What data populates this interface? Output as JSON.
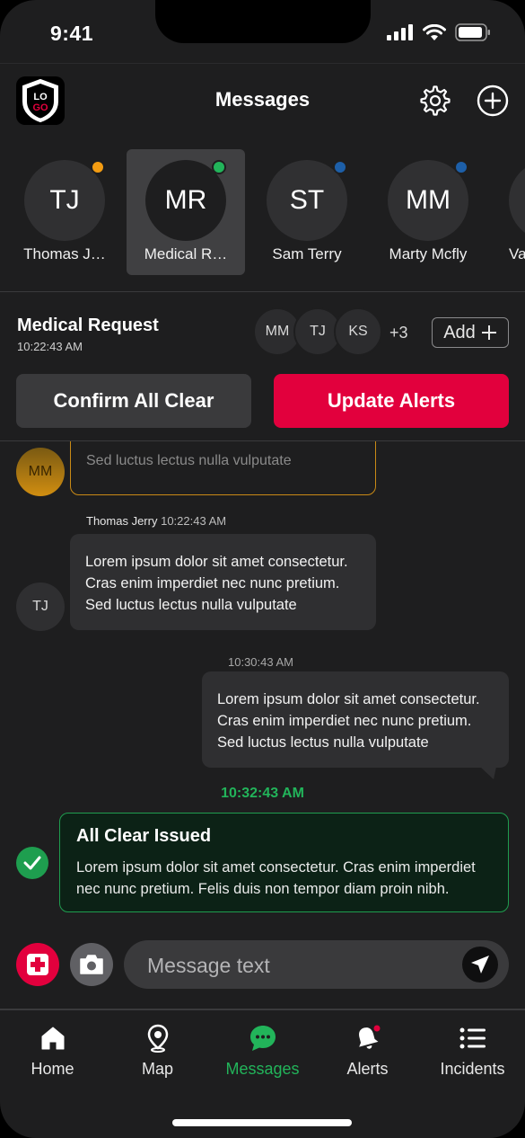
{
  "status_bar": {
    "time": "9:41"
  },
  "header": {
    "logo_line1": "LO",
    "logo_line2": "GO",
    "title": "Messages"
  },
  "contacts": [
    {
      "initials": "TJ",
      "name": "Thomas J…",
      "status_color": "#f39c12",
      "active": false
    },
    {
      "initials": "MR",
      "name": "Medical R…",
      "status_color": "#22b45a",
      "active": true
    },
    {
      "initials": "ST",
      "name": "Sam Terry",
      "status_color": "#1d5fa8",
      "active": false
    },
    {
      "initials": "MM",
      "name": "Marty Mcfly",
      "status_color": "#1d5fa8",
      "active": false
    },
    {
      "initials": "",
      "name": "Va",
      "status_color": "",
      "active": false
    }
  ],
  "request": {
    "title": "Medical Request",
    "time": "10:22:43 AM",
    "participants": [
      "MM",
      "TJ",
      "KS"
    ],
    "more": "+3",
    "add_label": "Add"
  },
  "actions": {
    "confirm_label": "Confirm All Clear",
    "update_label": "Update Alerts"
  },
  "messages": {
    "cut_avatar": "MM",
    "cut_text": "Sed luctus lectus nulla vulputate",
    "incoming": {
      "sender": "Thomas Jerry",
      "time": "10:22:43 AM",
      "avatar": "TJ",
      "lines": [
        "Lorem ipsum dolor sit amet consectetur.",
        "Cras enim imperdiet nec nunc pretium.",
        "Sed luctus lectus nulla vulputate"
      ]
    },
    "outgoing": {
      "time": "10:30:43 AM",
      "lines": [
        "Lorem ipsum dolor sit amet consectetur.",
        "Cras enim imperdiet nec nunc pretium.",
        "Sed luctus lectus nulla vulputate"
      ]
    },
    "system_time": "10:32:43 AM",
    "all_clear": {
      "title": "All Clear Issued",
      "body": "Lorem ipsum dolor sit amet consectetur. Cras enim imperdiet nec nunc pretium. Felis duis non tempor diam proin nibh."
    }
  },
  "composer": {
    "placeholder": "Message text"
  },
  "tabs": [
    {
      "label": "Home",
      "icon": "home-icon"
    },
    {
      "label": "Map",
      "icon": "map-pin-icon"
    },
    {
      "label": "Messages",
      "icon": "chat-icon"
    },
    {
      "label": "Alerts",
      "icon": "bell-icon"
    },
    {
      "label": "Incidents",
      "icon": "list-icon"
    }
  ],
  "colors": {
    "accent_red": "#e2003d",
    "accent_green": "#22b45a",
    "warning_orange": "#c98a16"
  }
}
